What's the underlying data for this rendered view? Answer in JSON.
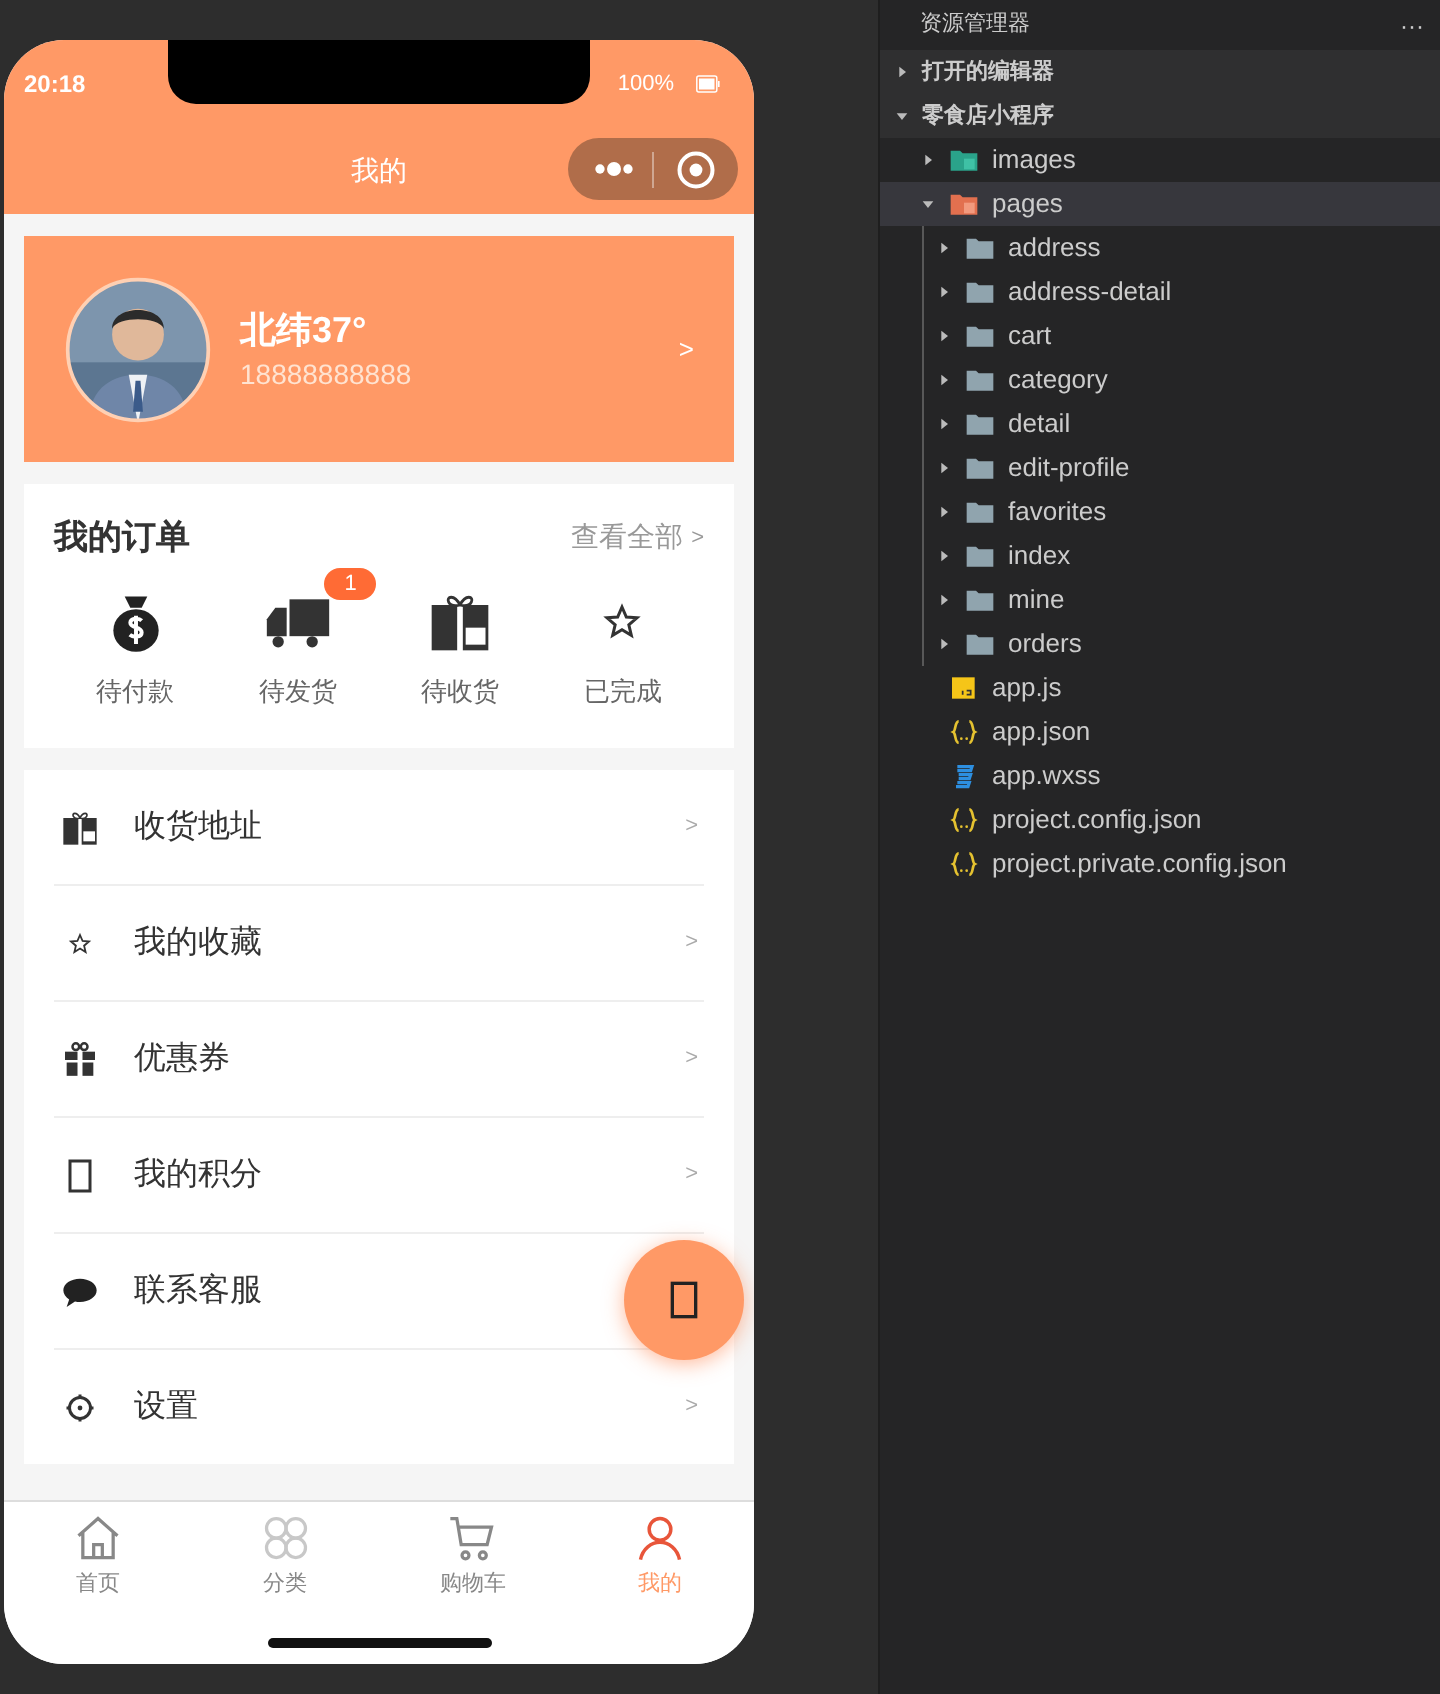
{
  "phone": {
    "status_bar": {
      "time": "20:18",
      "battery": "100%"
    },
    "nav_title": "我的",
    "profile": {
      "name": "北纬37°",
      "phone": "18888888888",
      "chevron": ">"
    },
    "orders": {
      "title": "我的订单",
      "view_all": "查看全部",
      "view_all_chevron": ">",
      "items": [
        {
          "label": "待付款",
          "kind": "money"
        },
        {
          "label": "待发货",
          "kind": "truck",
          "badge": "1"
        },
        {
          "label": "待收货",
          "kind": "gift"
        },
        {
          "label": "已完成",
          "kind": "star"
        }
      ]
    },
    "menu": [
      {
        "label": "收货地址",
        "kind": "gift",
        "chevron": ">"
      },
      {
        "label": "我的收藏",
        "kind": "star",
        "chevron": ">"
      },
      {
        "label": "优惠券",
        "kind": "present",
        "chevron": ">"
      },
      {
        "label": "我的积分",
        "kind": "square",
        "chevron": ">"
      },
      {
        "label": "联系客服",
        "kind": "chat"
      },
      {
        "label": "设置",
        "kind": "gear",
        "chevron": ">"
      }
    ],
    "tab_bar": [
      {
        "label": "首页",
        "kind": "home",
        "selected": false
      },
      {
        "label": "分类",
        "kind": "category",
        "selected": false
      },
      {
        "label": "购物车",
        "kind": "cart",
        "selected": false
      },
      {
        "label": "我的",
        "kind": "user",
        "selected": true
      }
    ]
  },
  "explorer": {
    "title": "资源管理器",
    "more": "···",
    "sections": [
      {
        "label": "打开的编辑器",
        "expanded": false
      },
      {
        "label": "零食店小程序",
        "expanded": true
      }
    ],
    "tree": [
      {
        "name": "images",
        "kind": "images",
        "expanded": false,
        "selected": false
      },
      {
        "name": "pages",
        "kind": "pages",
        "expanded": true,
        "selected": true,
        "children": [
          {
            "name": "address",
            "kind": "folder",
            "expanded": false,
            "selected": false
          },
          {
            "name": "address-detail",
            "kind": "folder",
            "expanded": false,
            "selected": false
          },
          {
            "name": "cart",
            "kind": "folder",
            "expanded": false,
            "selected": false
          },
          {
            "name": "category",
            "kind": "folder",
            "expanded": false,
            "selected": false
          },
          {
            "name": "detail",
            "kind": "folder",
            "expanded": false,
            "selected": false
          },
          {
            "name": "edit-profile",
            "kind": "folder",
            "expanded": false,
            "selected": false
          },
          {
            "name": "favorites",
            "kind": "folder",
            "expanded": false,
            "selected": false
          },
          {
            "name": "index",
            "kind": "folder",
            "expanded": false,
            "selected": false
          },
          {
            "name": "mine",
            "kind": "folder",
            "expanded": false,
            "selected": false
          },
          {
            "name": "orders",
            "kind": "folder",
            "expanded": false,
            "selected": false
          }
        ]
      },
      {
        "name": "app.js",
        "kind": "js",
        "selected": false
      },
      {
        "name": "app.json",
        "kind": "json",
        "selected": false
      },
      {
        "name": "app.wxss",
        "kind": "wxss",
        "selected": false
      },
      {
        "name": "project.config.json",
        "kind": "json",
        "selected": false
      },
      {
        "name": "project.private.config.json",
        "kind": "json",
        "selected": false
      }
    ]
  }
}
